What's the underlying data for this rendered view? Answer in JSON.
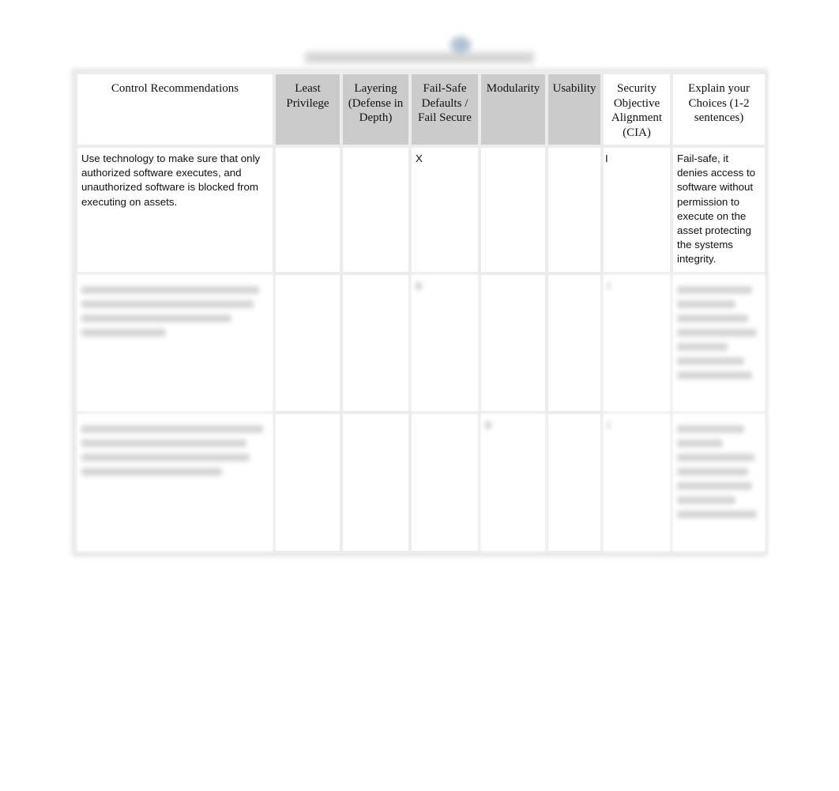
{
  "document": {
    "title_obscured": true
  },
  "table": {
    "headers": [
      "Control Recommendations",
      "Least Privilege",
      "Layering (Defense in Depth)",
      "Fail-Safe Defaults / Fail Secure",
      "Modularity",
      "Usability",
      "Security Objective Alignment (CIA)",
      "Explain your Choices (1-2 sentences)"
    ],
    "rows": [
      {
        "control": "Use technology to make sure that only authorized software executes, and unauthorized software is blocked from executing on assets.",
        "least_privilege": "",
        "layering": "",
        "fail_safe": "X",
        "modularity": "",
        "usability": "",
        "cia": "I",
        "explanation": "Fail-safe, it denies access to software without permission to execute on the asset protecting the systems integrity."
      },
      {
        "obscured": true
      },
      {
        "obscured": true
      }
    ]
  }
}
